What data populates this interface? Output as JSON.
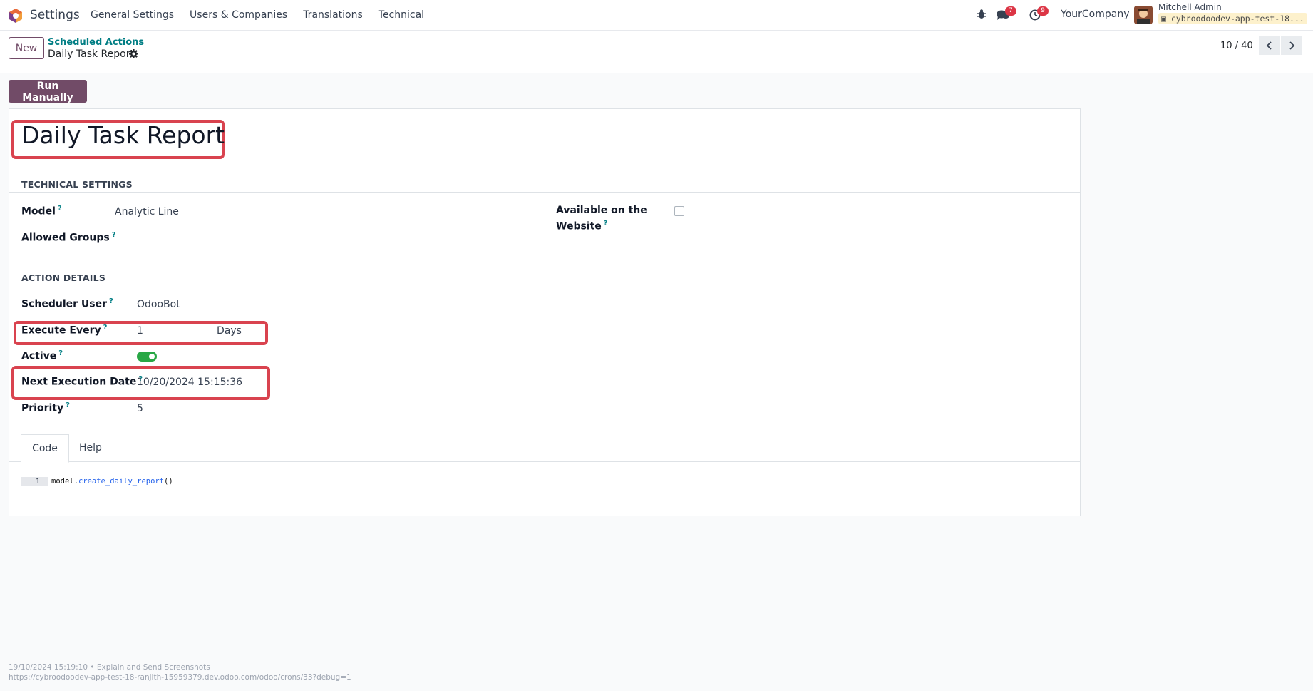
{
  "navbar": {
    "app_name": "Settings",
    "menu": [
      "General Settings",
      "Users & Companies",
      "Translations",
      "Technical"
    ],
    "messages_count": "7",
    "activities_count": "9",
    "company": "YourCompany",
    "user_name": "Mitchell Admin",
    "db_name": "cybroodoodev-app-test-18..."
  },
  "control": {
    "new_label": "New",
    "breadcrumb_parent": "Scheduled Actions",
    "breadcrumb_current": "Daily Task Report",
    "pager": "10 / 40"
  },
  "actions": {
    "run_manually": "Run Manually"
  },
  "form": {
    "title": "Daily Task Report",
    "technical_settings_title": "TECHNICAL SETTINGS",
    "model_label": "Model",
    "model_value": "Analytic Line",
    "allowed_groups_label": "Allowed Groups",
    "website_label_1": "Available on the",
    "website_label_2": "Website",
    "action_details_title": "ACTION DETAILS",
    "scheduler_user_label": "Scheduler User",
    "scheduler_user_value": "OdooBot",
    "execute_every_label": "Execute Every",
    "execute_every_value": "1",
    "execute_every_unit": "Days",
    "active_label": "Active",
    "next_execution_label": "Next Execution Date",
    "next_execution_value": "10/20/2024 15:15:36",
    "priority_label": "Priority",
    "priority_value": "5",
    "website_checked": false,
    "active_on": true
  },
  "tabs": {
    "code": "Code",
    "help": "Help"
  },
  "code": {
    "line_no": "1",
    "obj": "model",
    "dot": ".",
    "fn": "create_daily_report",
    "parens": "()"
  },
  "footer": {
    "line1": "19/10/2024 15:19:10 • Explain and Send Screenshots",
    "line2": "https://cybroodoodev-app-test-18-ranjith-15959379.dev.odoo.com/odoo/crons/33?debug=1"
  },
  "colors": {
    "brand": "#714b67",
    "link": "#017e84",
    "highlight": "#d9434f",
    "toggle": "#28a745"
  }
}
